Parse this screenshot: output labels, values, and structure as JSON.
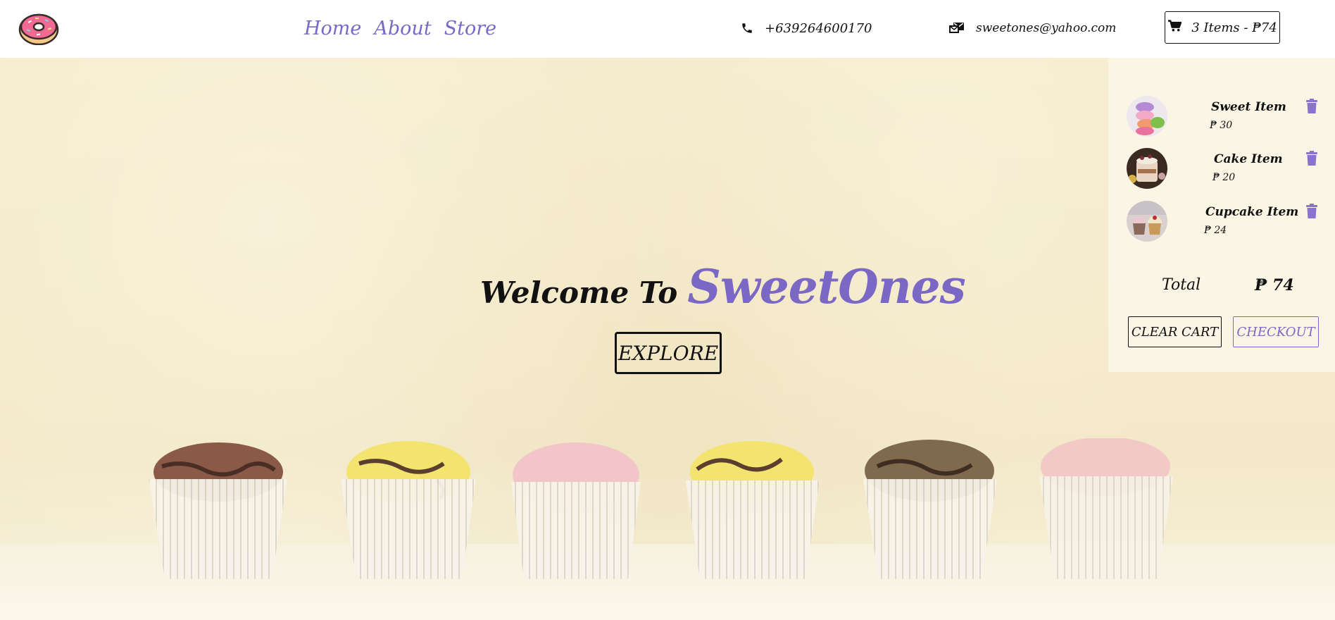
{
  "colors": {
    "accent": "#7b68c4",
    "text": "#111111",
    "hero_background": "#f6eccd",
    "cart_panel": "#faf5e6"
  },
  "nav": {
    "logo_icon": "donut-icon",
    "links": [
      "Home",
      "About",
      "Store"
    ],
    "phone": {
      "icon": "phone-icon",
      "text": "+639264600170"
    },
    "email": {
      "icon": "envelope-icon",
      "text": "sweetones@yahoo.com"
    },
    "cart": {
      "icon": "shopping-cart-icon",
      "summary": "3 Items - ₱74"
    }
  },
  "hero": {
    "welcome": "Welcome To",
    "brand": "SweetOnes",
    "explore_label": "EXPLORE"
  },
  "cart_panel": {
    "items": [
      {
        "title": "Sweet Item",
        "price": "₱ 30",
        "thumb": "macarons"
      },
      {
        "title": "Cake Item",
        "price": "₱ 20",
        "thumb": "cake"
      },
      {
        "title": "Cupcake Item",
        "price": "₱ 24",
        "thumb": "cupcake"
      }
    ],
    "total_label": "Total",
    "total_value": "₱ 74",
    "clear_label": "CLEAR CART",
    "checkout_label": "CHECKOUT"
  }
}
